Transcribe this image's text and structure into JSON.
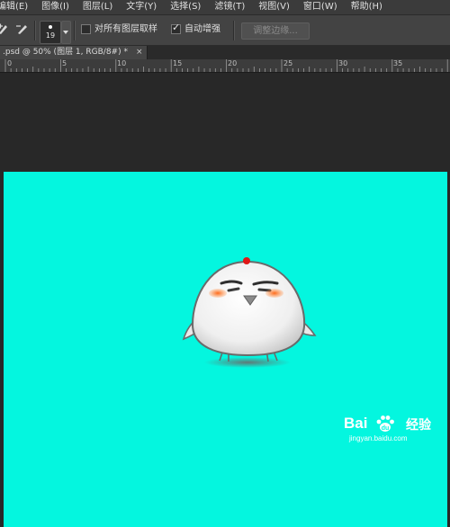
{
  "menubar": {
    "items": [
      "编辑(E)",
      "图像(I)",
      "图层(L)",
      "文字(Y)",
      "选择(S)",
      "滤镜(T)",
      "视图(V)",
      "窗口(W)",
      "帮助(H)"
    ]
  },
  "options": {
    "brush_size": "19",
    "sample_all_layers_label": "对所有图层取样",
    "sample_all_layers_checked": false,
    "auto_enhance_label": "自动增强",
    "auto_enhance_checked": true,
    "refine_edge_label": "调整边缘..."
  },
  "document": {
    "tab_title": ".psd @ 50% (图层 1, RGB/8#) *",
    "close_glyph": "×",
    "canvas_color": "#04f6df"
  },
  "ruler": {
    "labels": [
      "0",
      "5",
      "10",
      "15",
      "20",
      "25",
      "30",
      "35"
    ]
  },
  "watermark": {
    "brand": "Bai",
    "brand_suffix": "经验",
    "url": "jingyan.baidu.com"
  },
  "icons": [
    "brush-add-icon",
    "brush-subtract-icon",
    "checkmark-icon",
    "close-icon",
    "chevron-down-icon",
    "paw-icon"
  ]
}
